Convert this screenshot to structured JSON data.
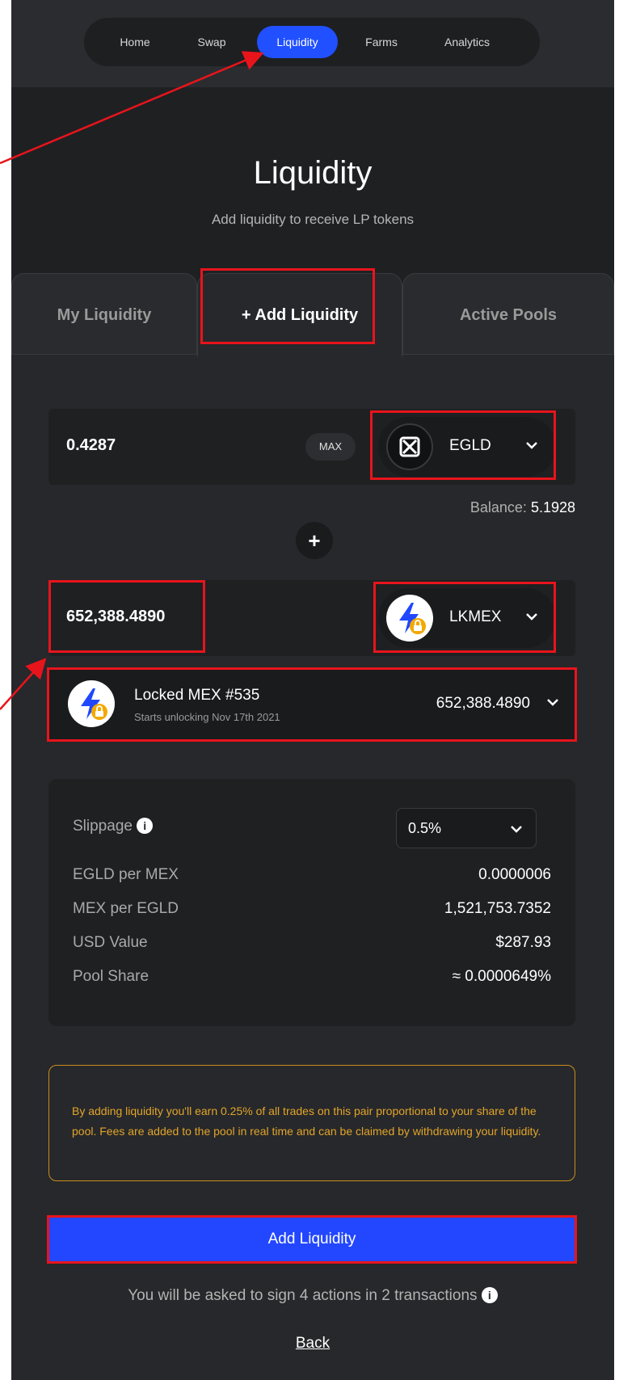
{
  "nav": {
    "items": [
      {
        "label": "Home",
        "active": false
      },
      {
        "label": "Swap",
        "active": false
      },
      {
        "label": "Liquidity",
        "active": true
      },
      {
        "label": "Farms",
        "active": false
      },
      {
        "label": "Analytics",
        "active": false
      }
    ]
  },
  "header": {
    "title": "Liquidity",
    "subtitle": "Add liquidity to receive LP tokens"
  },
  "tabs": [
    {
      "label": "My Liquidity",
      "active": false
    },
    {
      "label": "+ Add Liquidity",
      "active": true
    },
    {
      "label": "Active Pools",
      "active": false
    }
  ],
  "first_input": {
    "amount": "0.4287",
    "max_label": "MAX",
    "token": "EGLD",
    "token_icon": "egld-icon",
    "balance_label": "Balance:",
    "balance_value": "5.1928"
  },
  "plus_icon": "plus-icon",
  "second_input": {
    "amount": "652,388.4890",
    "token": "LKMEX",
    "token_icon": "locked-mex-icon"
  },
  "locked_token": {
    "name": "Locked MEX #535",
    "unlock_text": "Starts unlocking Nov 17th 2021",
    "amount": "652,388.4890",
    "icon": "locked-mex-icon"
  },
  "details": {
    "slippage_label": "Slippage",
    "slippage_value": "0.5%",
    "rows": [
      {
        "label": "EGLD per MEX",
        "value": "0.0000006"
      },
      {
        "label": "MEX per EGLD",
        "value": "1,521,753.7352"
      },
      {
        "label": "USD Value",
        "value": "$287.93"
      },
      {
        "label": "Pool Share",
        "value": "≈ 0.0000649%"
      }
    ]
  },
  "notice": "By adding liquidity you'll earn 0.25% of all trades on this pair proportional to your share of the pool. Fees are added to the pool in real time and can be claimed by withdrawing your liquidity.",
  "add_button": "Add Liquidity",
  "sign_text": "You will be asked to sign 4 actions in 2 transactions",
  "back_link": "Back",
  "colors": {
    "accent": "#2050ff",
    "annotation": "#e8141c",
    "warning": "#e2a52a"
  }
}
